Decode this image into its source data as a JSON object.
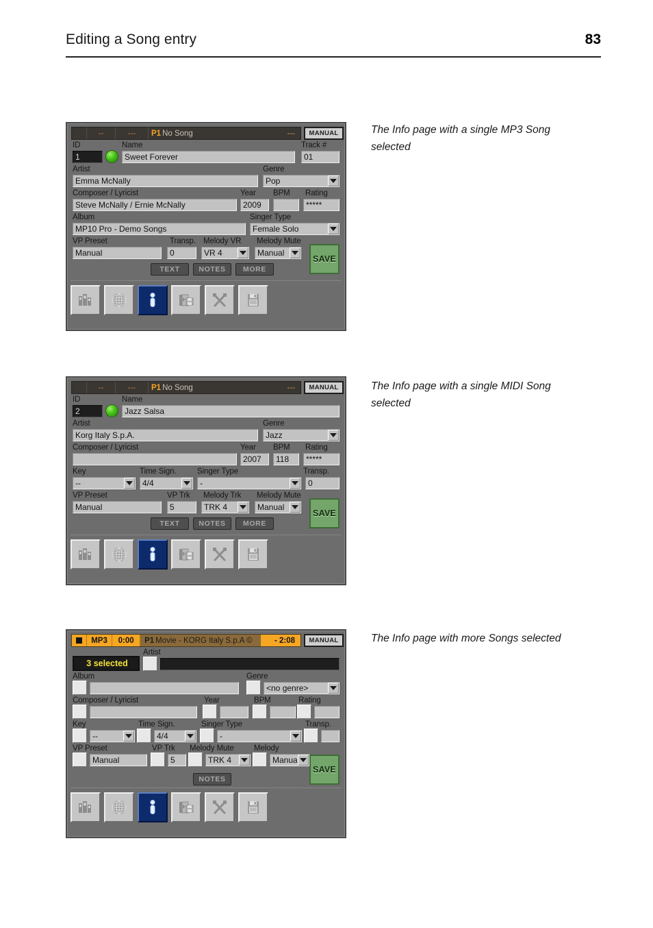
{
  "runhead": {
    "title": "Editing a Song entry",
    "page": "83"
  },
  "captions": {
    "mp3": "The Info page with a single MP3 Song selected",
    "midi": "The Info page with a single MIDI Song selected",
    "more": "The Info page with more Songs selected"
  },
  "common": {
    "manual_badge": "MANUAL",
    "save_label": "SAVE",
    "btn_text": "TEXT",
    "btn_notes": "NOTES",
    "btn_more": "MORE",
    "toolbar_icons": [
      "library-icon",
      "globe-icon",
      "info-icon",
      "song-book-save-icon",
      "tools-icon",
      "disk-save-icon"
    ],
    "accent_orange": "#f5a623",
    "led_green": "#47c418",
    "save_green": "#74a56a",
    "active_blue": "#0d2a6b"
  },
  "panel_mp3": {
    "titlebar": {
      "seg1": "",
      "seg2": "--",
      "seg3": "---",
      "p1": "P1",
      "song": "No Song",
      "right_dash": "---",
      "manual": "MANUAL"
    },
    "labels": {
      "id": "ID",
      "name": "Name",
      "track": "Track #",
      "artist": "Artist",
      "genre": "Genre",
      "composer": "Composer / Lyricist",
      "year": "Year",
      "bpm": "BPM",
      "rating": "Rating",
      "album": "Album",
      "singer_type": "Singer Type",
      "vp_preset": "VP Preset",
      "transp": "Transp.",
      "melody_vr": "Melody VR",
      "melody_mute": "Melody Mute"
    },
    "values": {
      "id": "1",
      "name": "Sweet Forever",
      "track": "01",
      "artist": "Emma McNally",
      "genre": "Pop",
      "composer": "Steve McNally / Ernie McNally",
      "year": "2009",
      "bpm": "",
      "rating": "*****",
      "album": "MP10 Pro - Demo Songs",
      "singer_type": "Female Solo",
      "vp_preset": "Manual",
      "transp": "0",
      "melody_vr": "VR 4",
      "melody_mute": "Manual"
    }
  },
  "panel_midi": {
    "titlebar": {
      "seg2": "--",
      "seg3": "---",
      "p1": "P1",
      "song": "No Song",
      "right_dash": "---",
      "manual": "MANUAL"
    },
    "labels": {
      "id": "ID",
      "name": "Name",
      "artist": "Artist",
      "genre": "Genre",
      "composer": "Composer / Lyricist",
      "year": "Year",
      "bpm": "BPM",
      "rating": "Rating",
      "key": "Key",
      "time_sign": "Time Sign.",
      "singer_type": "Singer Type",
      "transp": "Transp.",
      "vp_preset": "VP Preset",
      "vp_trk": "VP Trk",
      "melody_trk": "Melody Trk",
      "melody_mute": "Melody Mute"
    },
    "values": {
      "id": "2",
      "name": "Jazz Salsa",
      "artist": "Korg Italy S.p.A.",
      "genre": "Jazz",
      "composer": "",
      "year": "2007",
      "bpm": "118",
      "rating": "*****",
      "key": "--",
      "time_sign": "4/4",
      "singer_type": "-",
      "transp": "0",
      "vp_preset": "Manual",
      "vp_trk": "5",
      "melody_trk": "TRK 4",
      "melody_mute": "Manual"
    }
  },
  "panel_more": {
    "titlebar": {
      "mode": "MP3",
      "time": "0:00",
      "p1": "P1",
      "song": "Movie - KORG Italy S.p.A ©",
      "remaining": "- 2:08",
      "manual": "MANUAL"
    },
    "selected_badge": "3 selected",
    "labels": {
      "artist": "Artist",
      "album": "Album",
      "genre": "Genre",
      "composer": "Composer / Lyricist",
      "year": "Year",
      "bpm": "BPM",
      "rating": "Rating",
      "key": "Key",
      "time_sign": "Time Sign.",
      "singer_type": "Singer Type",
      "transp": "Transp.",
      "vp_preset": "VP Preset",
      "vp_trk": "VP Trk",
      "melody_mute": "Melody Mute",
      "melody": "Melody"
    },
    "values": {
      "artist": "",
      "album": "",
      "genre": "<no genre>",
      "composer": "",
      "year": "",
      "bpm": "",
      "rating": "",
      "key": "--",
      "time_sign": "4/4",
      "singer_type": "-",
      "transp": "",
      "vp_preset": "Manual",
      "vp_trk": "5",
      "melody_mute": "TRK 4",
      "melody": "Manual"
    },
    "btn_notes": "NOTES"
  }
}
